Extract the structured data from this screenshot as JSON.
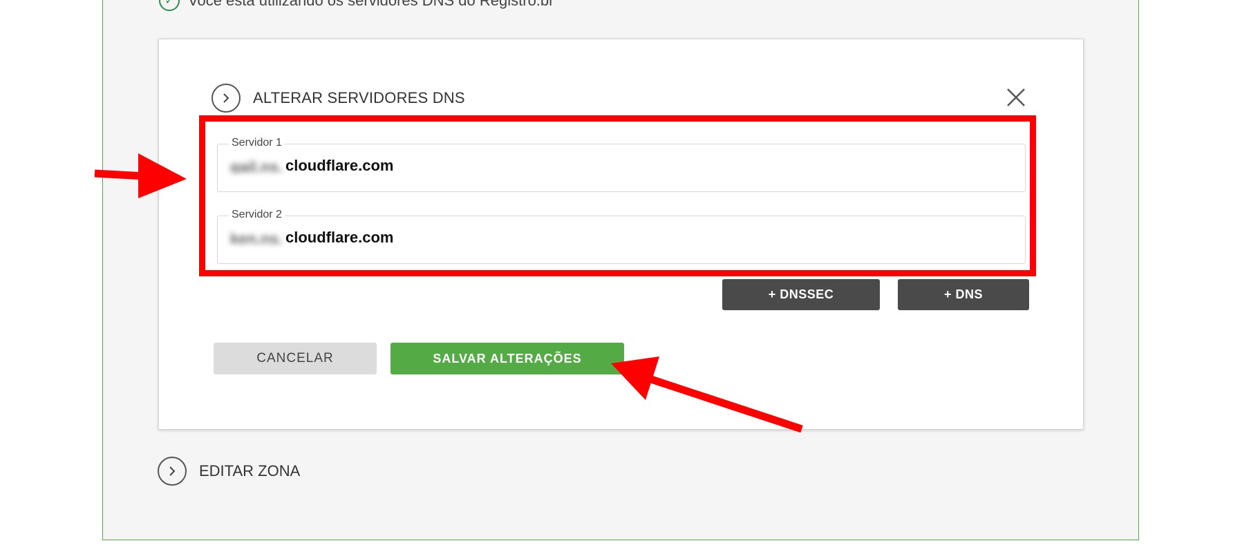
{
  "notice": {
    "text": "Você está utilizando os servidores DNS do Registro.br"
  },
  "modal": {
    "title": "ALTERAR SERVIDORES DNS",
    "fields": [
      {
        "label": "Servidor 1",
        "value_prefix": "gail.ns.",
        "value_suffix": "cloudflare.com"
      },
      {
        "label": "Servidor 2",
        "value_prefix": "ken.ns.",
        "value_suffix": "cloudflare.com"
      }
    ],
    "buttons": {
      "dnssec": "+ DNSSEC",
      "dns": "+ DNS",
      "cancel": "CANCELAR",
      "save": "SALVAR ALTERAÇÕES"
    }
  },
  "sections": {
    "edit_zone": "EDITAR ZONA"
  },
  "colors": {
    "accent_green": "#54aa45",
    "border_green": "#5aa845",
    "annotation_red": "#ff0000",
    "dark_button": "#4a4a4a"
  }
}
